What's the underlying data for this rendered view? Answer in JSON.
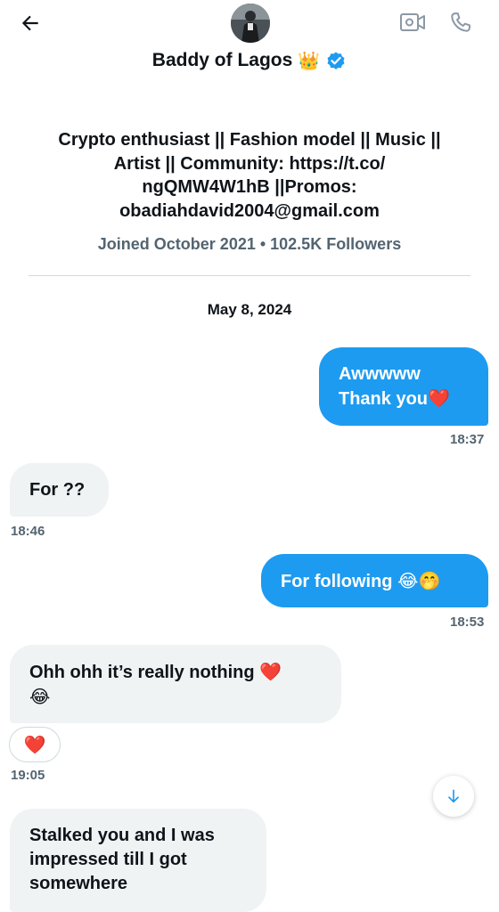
{
  "header": {
    "name": "Baddy of Lagos",
    "name_emoji": "👑",
    "icons": {
      "back": "back-arrow-icon",
      "video": "video-call-icon",
      "call": "phone-icon",
      "verified": "verified-badge-icon"
    },
    "accent": "#1d9bf0"
  },
  "profile": {
    "bio": "Crypto enthusiast || Fashion model || Music || Artist || Community: https://t.co/ ngQMW4W1hB ||Promos: obadiahdavid2004@gmail.com",
    "bio_lines": [
      "Crypto enthusiast || Fashion model || Music ||",
      "Artist || Community: https://t.co/",
      "ngQMW4W1hB ||Promos:",
      "obadiahdavid2004@gmail.com"
    ],
    "joined_followers": "Joined October 2021 • 102.5K Followers"
  },
  "conversation": {
    "date": "May 8, 2024",
    "messages": [
      {
        "direction": "out",
        "lines": [
          "Awwwww",
          "Thank you"
        ],
        "emoji": "❤️",
        "time": "18:37"
      },
      {
        "direction": "in",
        "lines": [
          "For ??"
        ],
        "time": "18:46"
      },
      {
        "direction": "out",
        "lines": [
          "For following"
        ],
        "emoji": "😂🤭",
        "time": "18:53"
      },
      {
        "direction": "in",
        "lines": [
          "Ohh ohh it’s really nothing"
        ],
        "emoji": "❤️",
        "emoji2": "😂",
        "reaction": "❤️",
        "time": "19:05"
      },
      {
        "direction": "in",
        "lines": [
          "Stalked you and I was",
          "impressed till I got",
          "somewhere"
        ]
      }
    ]
  },
  "scroll_down_icon": "arrow-down-icon"
}
